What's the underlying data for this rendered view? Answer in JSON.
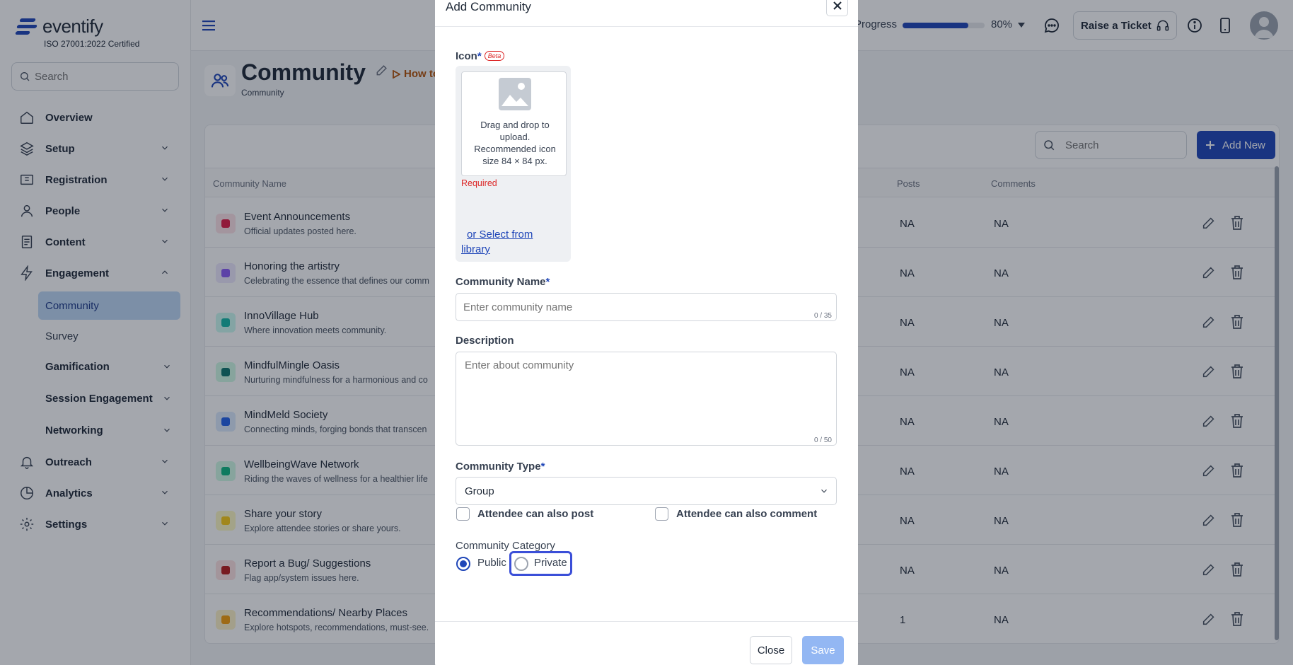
{
  "brand": {
    "name": "eventify",
    "certification": "ISO 27001:2022 Certified"
  },
  "sidebar": {
    "search_placeholder": "Search",
    "items": [
      {
        "label": "Overview",
        "icon": "home-icon"
      },
      {
        "label": "Setup",
        "icon": "layers-icon"
      },
      {
        "label": "Registration",
        "icon": "ticket-icon"
      },
      {
        "label": "People",
        "icon": "user-icon"
      },
      {
        "label": "Content",
        "icon": "document-icon"
      },
      {
        "label": "Engagement",
        "icon": "bolt-icon"
      },
      {
        "label": "Outreach",
        "icon": "bell-icon"
      },
      {
        "label": "Analytics",
        "icon": "pie-icon"
      },
      {
        "label": "Settings",
        "icon": "gear-icon"
      }
    ],
    "engagement_sub": [
      "Community",
      "Survey",
      "Gamification",
      "Session Engagement",
      "Networking"
    ]
  },
  "topbar": {
    "progress_label": "Progress",
    "progress_value": 0.8,
    "progress_percent": "80%",
    "ticket_label": "Raise a Ticket"
  },
  "page": {
    "title": "Community",
    "breadcrumb": "Community",
    "howto": "How to"
  },
  "table": {
    "search_placeholder": "Search",
    "add_label": "Add New",
    "columns": {
      "name": "Community Name",
      "posts": "Posts",
      "comments": "Comments"
    },
    "rows": [
      {
        "name": "Event Announcements",
        "desc": "Official updates posted here.",
        "posts": "NA",
        "comments": "NA",
        "color": "#e11d48",
        "bg": "#fde2e7"
      },
      {
        "name": "Honoring the artistry",
        "desc": "Celebrating the essence that defines our comm",
        "posts": "NA",
        "comments": "NA",
        "color": "#8b5cf6",
        "bg": "#ede9fe"
      },
      {
        "name": "InnoVillage Hub",
        "desc": "Where innovation meets community.",
        "posts": "NA",
        "comments": "NA",
        "color": "#14b8a6",
        "bg": "#ccfbf1"
      },
      {
        "name": "MindfulMingle Oasis",
        "desc": "Nurturing mindfulness for a harmonious and co",
        "posts": "NA",
        "comments": "NA",
        "color": "#0f766e",
        "bg": "#d1fae5"
      },
      {
        "name": "MindMeld Society",
        "desc": "Connecting minds, forging bonds that transcen",
        "posts": "NA",
        "comments": "NA",
        "color": "#2563eb",
        "bg": "#dbeafe"
      },
      {
        "name": "WellbeingWave Network",
        "desc": "Riding the waves of wellness for a healthier life",
        "posts": "NA",
        "comments": "NA",
        "color": "#10b981",
        "bg": "#d1fae5"
      },
      {
        "name": "Share your story",
        "desc": "Explore attendee stories or share yours.",
        "posts": "NA",
        "comments": "NA",
        "color": "#facc15",
        "bg": "#fef9c3"
      },
      {
        "name": "Report a Bug/ Suggestions",
        "desc": "Flag app/system issues here.",
        "posts": "NA",
        "comments": "NA",
        "color": "#b91c1c",
        "bg": "#fee2e2"
      },
      {
        "name": "Recommendations/ Nearby Places",
        "desc": "Explore hotspots, recommendations, must-see.",
        "posts": "1",
        "comments": "NA",
        "color": "#f59e0b",
        "bg": "#fef3c7"
      }
    ]
  },
  "modal": {
    "title": "Add Community",
    "icon_label": "Icon",
    "required_mark": "*",
    "beta": "Beta",
    "upload_text": "Drag and drop to upload. Recommended icon size 84 × 84 px.",
    "upload_required": "Required",
    "upload_link": "or Select from library",
    "name_label": "Community Name",
    "name_placeholder": "Enter community name",
    "name_counter": "0 / 35",
    "desc_label": "Description",
    "desc_placeholder": "Enter about community",
    "desc_counter": "0 / 50",
    "type_label": "Community Type",
    "type_value": "Group",
    "check_post": "Attendee can also post",
    "check_comment": "Attendee can also comment",
    "category_label": "Community Category",
    "radio_public": "Public",
    "radio_private": "Private",
    "close_label": "Close",
    "save_label": "Save"
  }
}
